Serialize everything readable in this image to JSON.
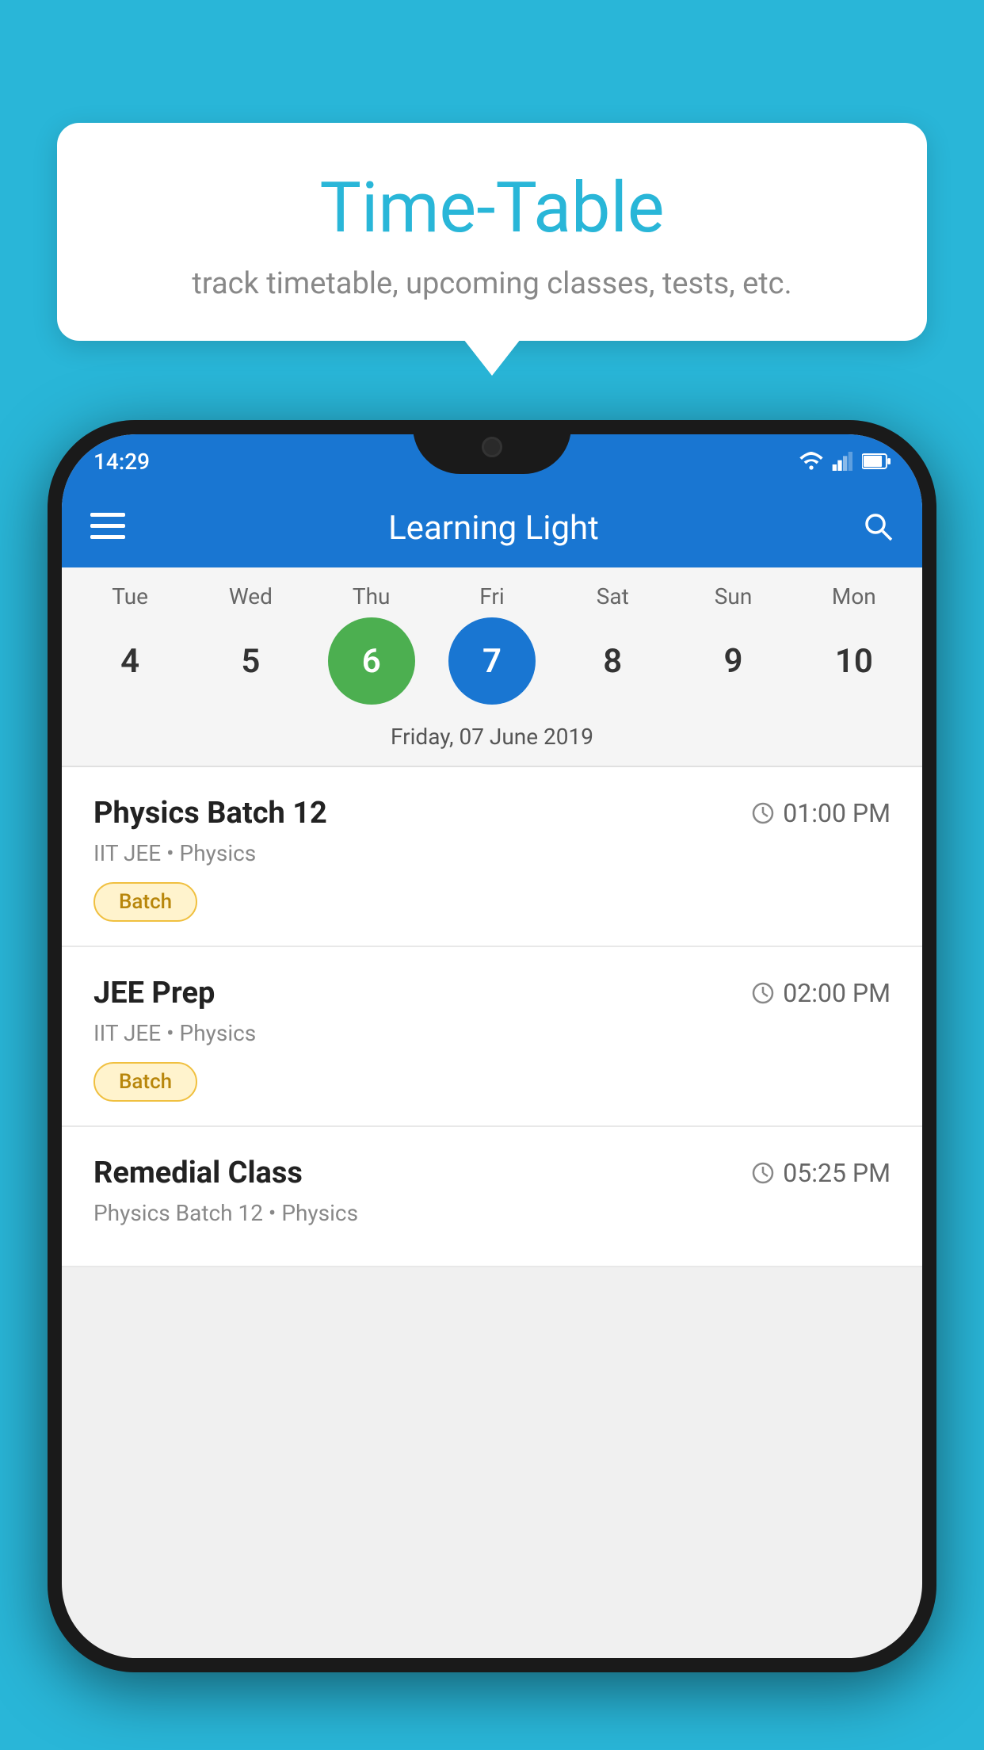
{
  "background": {
    "color": "#29b6d8"
  },
  "tooltip": {
    "title": "Time-Table",
    "subtitle": "track timetable, upcoming classes, tests, etc."
  },
  "phone": {
    "status_bar": {
      "time": "14:29"
    },
    "app_bar": {
      "title": "Learning Light"
    },
    "calendar": {
      "days_of_week": [
        "Tue",
        "Wed",
        "Thu",
        "Fri",
        "Sat",
        "Sun",
        "Mon"
      ],
      "dates": [
        "4",
        "5",
        "6",
        "7",
        "8",
        "9",
        "10"
      ],
      "today_index": 2,
      "selected_index": 3,
      "selected_date_label": "Friday, 07 June 2019"
    },
    "schedule_items": [
      {
        "title": "Physics Batch 12",
        "time": "01:00 PM",
        "subtitle": "IIT JEE • Physics",
        "badge": "Batch"
      },
      {
        "title": "JEE Prep",
        "time": "02:00 PM",
        "subtitle": "IIT JEE • Physics",
        "badge": "Batch"
      },
      {
        "title": "Remedial Class",
        "time": "05:25 PM",
        "subtitle": "Physics Batch 12 • Physics",
        "badge": null
      }
    ]
  }
}
